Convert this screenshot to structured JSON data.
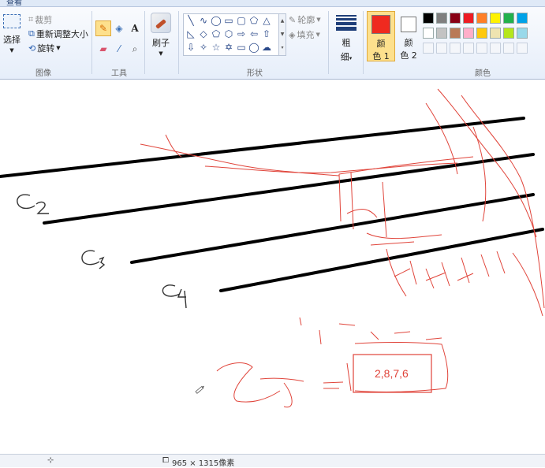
{
  "tab_partial": "查看",
  "image_group": {
    "select_label": "选择",
    "crop_label": "裁剪",
    "resize_label": "重新调整大小",
    "rotate_label": "旋转",
    "group_label": "图像"
  },
  "tools_group": {
    "group_label": "工具",
    "text_tool_glyph": "A"
  },
  "brush_group": {
    "label": "刷子"
  },
  "shapes_group": {
    "group_label": "形状",
    "outline_label": "轮廓",
    "fill_label": "填充"
  },
  "size_group": {
    "label_line1": "粗",
    "label_line2": "细"
  },
  "color1": {
    "line1": "颜",
    "line2": "色 1",
    "value": "#ef2a1f"
  },
  "color2": {
    "line1": "颜",
    "line2": "色 2",
    "value": "#ffffff"
  },
  "colors_group": {
    "group_label": "颜色",
    "palette": [
      "#000000",
      "#7f7f7f",
      "#880015",
      "#ed1c24",
      "#ff7f27",
      "#fff200",
      "#22b14c",
      "#00a2e8",
      "#ffffff",
      "#c3c3c3",
      "#b97a57",
      "#ffaec9",
      "#ffc90e",
      "#efe4b0",
      "#b5e61d",
      "#99d9ea"
    ]
  },
  "canvas": {
    "label_c2": "C2",
    "label_c3": "C3",
    "label_c4": "C4",
    "label_c5": "C5",
    "boxed_text": "2,8,7,6"
  },
  "statusbar": {
    "size_text": "965 × 1315像素"
  }
}
